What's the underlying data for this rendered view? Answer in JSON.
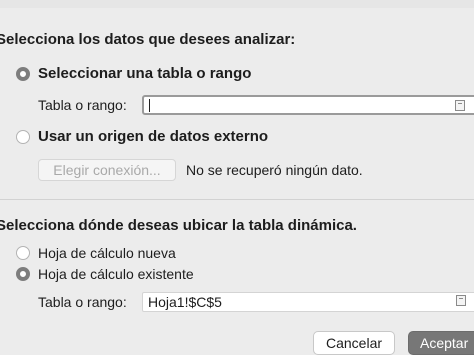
{
  "data_section": {
    "heading": "Selecciona los datos que desees analizar:",
    "option_table_range": "Seleccionar una tabla o rango",
    "table_range_label": "Tabla o rango:",
    "table_range_value": "",
    "option_external_source": "Usar un origen de datos externo",
    "choose_connection_button": "Elegir conexión...",
    "no_data_message": "No se recuperó ningún dato."
  },
  "placement_section": {
    "heading": "Selecciona dónde deseas ubicar la tabla dinámica.",
    "option_new_sheet": "Hoja de cálculo nueva",
    "option_existing_sheet": "Hoja de cálculo existente",
    "table_range_label": "Tabla o rango:",
    "table_range_value": "Hoja1!$C$5"
  },
  "footer": {
    "cancel_label": "Cancelar",
    "accept_label": "Aceptar"
  },
  "selected": {
    "data_source": "table_range",
    "placement": "existing_sheet"
  }
}
